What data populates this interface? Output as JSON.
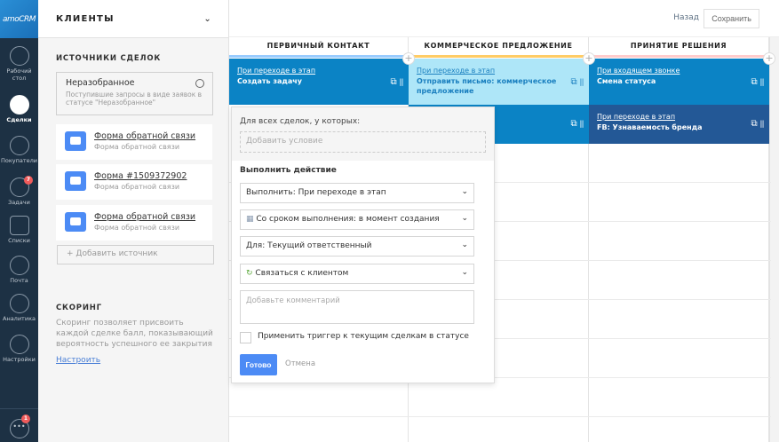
{
  "nav": {
    "logo": "amoCRM",
    "items": [
      {
        "label": "Рабочий стол",
        "icon": "dashboard-icon"
      },
      {
        "label": "Сделки",
        "icon": "deals-icon",
        "active": true
      },
      {
        "label": "Покупатели",
        "icon": "customers-icon"
      },
      {
        "label": "Задачи",
        "icon": "tasks-icon",
        "badge": "7"
      },
      {
        "label": "Списки",
        "icon": "lists-icon"
      },
      {
        "label": "Почта",
        "icon": "mail-icon"
      },
      {
        "label": "Аналитика",
        "icon": "analytics-icon"
      },
      {
        "label": "Настройки",
        "icon": "settings-icon"
      }
    ],
    "chat_badge": "1"
  },
  "panel": {
    "title": "КЛИЕНТЫ",
    "sources_title": "ИСТОЧНИКИ СДЕЛОК",
    "unsorted": {
      "title": "Неразобранное",
      "desc": "Поступившие запросы в виде заявок в статусе \"Неразобранное\""
    },
    "sources": [
      {
        "name": "Форма обратной связи",
        "sub": "Форма обратной связи"
      },
      {
        "name": "Форма #1509372902",
        "sub": "Форма обратной связи"
      },
      {
        "name": "Форма обратной связи",
        "sub": "Форма обратной связи"
      }
    ],
    "add_source": "Добавить источник",
    "scoring_title": "СКОРИНГ",
    "scoring_desc": "Скоринг позволяет присвоить каждой сделке балл, показывающий вероятность успешного ее закрытия",
    "scoring_link": "Настроить"
  },
  "toolbar": {
    "back": "Назад",
    "save": "Сохранить"
  },
  "columns": [
    {
      "title": "ПЕРВИЧНЫЙ КОНТАКТ",
      "color": "#99ccff"
    },
    {
      "title": "КОММЕРЧЕСКОЕ ПРЕДЛОЖЕНИЕ",
      "color": "#ffcc66"
    },
    {
      "title": "ПРИНЯТИЕ РЕШЕНИЯ",
      "color": "#ffcccc"
    }
  ],
  "triggers": [
    {
      "link": "При переходе в этап",
      "action": "Создать задачу"
    },
    {
      "link": "При переходе в этап",
      "action": "Отправить письмо: коммерческое предложение"
    },
    {
      "link": "При входящем звонке",
      "action": "Смена статуса"
    },
    {
      "link": "При переходе в этап",
      "action": "FB: Узнаваемость бренда"
    }
  ],
  "popup": {
    "cond_label": "Для всех сделок, у которых:",
    "cond_placeholder": "Добавить условие",
    "action_title": "Выполнить действие",
    "selects": [
      "Выполнить: При переходе в этап",
      "Со сроком выполнения: в момент создания",
      "Для: Текущий ответственный",
      "Связаться с клиентом"
    ],
    "comment_placeholder": "Добавьте комментарий",
    "apply_label": "Применить триггер к текущим сделкам в статусе",
    "ok": "Готово",
    "cancel": "Отмена"
  }
}
